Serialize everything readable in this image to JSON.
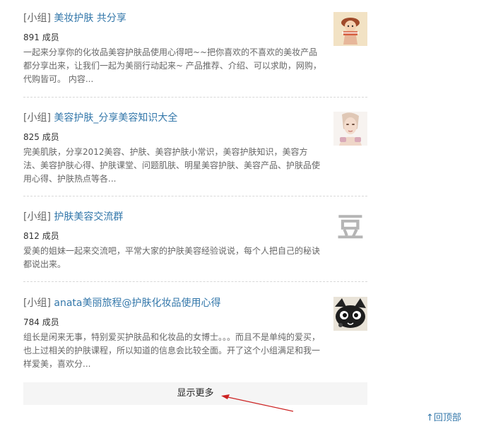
{
  "results": [
    {
      "tag": "[小组]",
      "title": "美妆护肤 共分享",
      "members": "891 成员",
      "description": "一起来分享你的化妆品美容护肤品使用心得吧~~把你喜欢的不喜欢的美妆产品都分享出来，让我们一起为美丽行动起来~ 产品推荐、介绍、可以求助，网购，代购皆可。 内容...",
      "thumbnail": "cartoon-girl-icon"
    },
    {
      "tag": "[小组]",
      "title": "美容护肤_分享美容知识大全",
      "members": "825 成员",
      "description": "完美肌肤，分享2012美容、护肤、美容护肤小常识，美容护肤知识，美容方法、美容护肤心得、护肤课堂、问题肌肤、明星美容护肤、美容产品、护肤品使用心得、护肤热点等各...",
      "thumbnail": "face-portrait-icon"
    },
    {
      "tag": "[小组]",
      "title": "护肤美容交流群",
      "members": "812 成员",
      "description": "爱美的姐妹一起来交流吧，平常大家的护肤美容经验说说，每个人把自己的秘诀都说出来。",
      "thumbnail": "douban-logo-icon",
      "thumbnail_glyph": "豆"
    },
    {
      "tag": "[小组]",
      "title": "anata美丽旅程@护肤化妆品使用心得",
      "members": "784 成员",
      "description": "组长是闲来无事，特别爱买护肤品和化妆品的女博士。。。而且不是单纯的爱买，也上过相关的护肤课程，所以知道的信息会比较全面。开了这个小组满足和我一样爱美，喜欢分...",
      "thumbnail": "cartoon-animal-icon"
    }
  ],
  "show_more_label": "显示更多",
  "back_to_top_label": "↑回顶部",
  "colors": {
    "link": "#3377aa",
    "annotation_arrow": "#cc2222"
  }
}
